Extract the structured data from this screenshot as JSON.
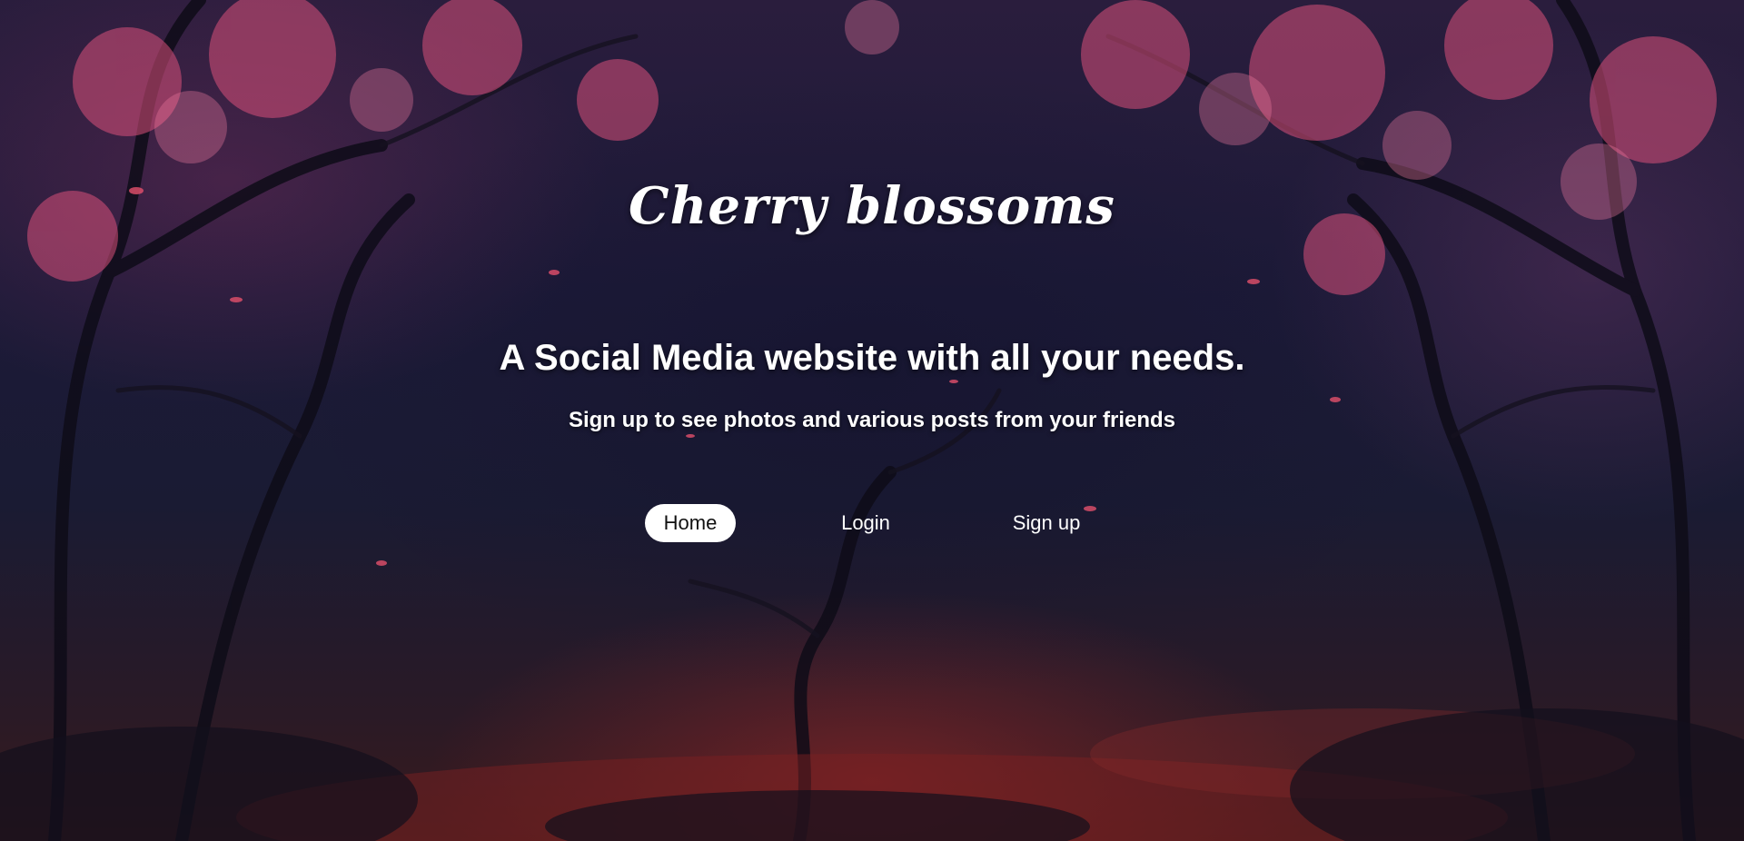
{
  "brand": {
    "title": "Cherry blossoms"
  },
  "hero": {
    "headline": "A Social Media website with all your needs.",
    "subline": "Sign up to see photos and various posts from your friends"
  },
  "nav": {
    "items": [
      {
        "label": "Home",
        "active": true
      },
      {
        "label": "Login",
        "active": false
      },
      {
        "label": "Sign up",
        "active": false
      }
    ]
  },
  "colors": {
    "text": "#ffffff",
    "active_pill_bg": "#ffffff",
    "active_pill_text": "#111111",
    "blossom_pink": "#d9507a",
    "night_sky": "#1c1a38"
  },
  "background": {
    "icon": "cherry-blossom-forest-illustration"
  }
}
